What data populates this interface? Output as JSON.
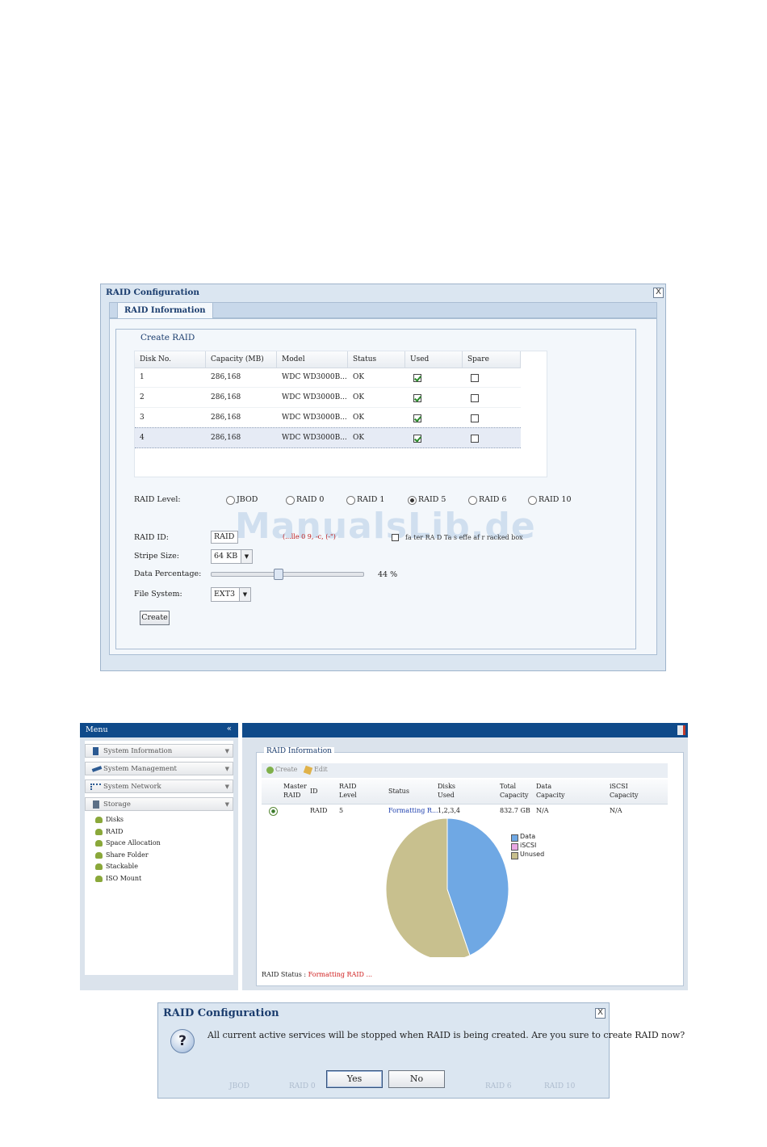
{
  "raid_config": {
    "title": "RAID Configuration",
    "close_label": "X",
    "tab": "RAID Information",
    "section": "Create RAID",
    "columns": [
      "Disk No.",
      "Capacity (MB)",
      "Model",
      "Status",
      "Used",
      "Spare"
    ],
    "disks": [
      {
        "no": "1",
        "capacity": "286,168",
        "model": "WDC WD3000B...",
        "status": "OK",
        "used": true,
        "spare": false
      },
      {
        "no": "2",
        "capacity": "286,168",
        "model": "WDC WD3000B...",
        "status": "OK",
        "used": true,
        "spare": false
      },
      {
        "no": "3",
        "capacity": "286,168",
        "model": "WDC WD3000B...",
        "status": "OK",
        "used": true,
        "spare": false
      },
      {
        "no": "4",
        "capacity": "286,168",
        "model": "WDC WD3000B...",
        "status": "OK",
        "used": true,
        "spare": false
      }
    ],
    "raid_level_label": "RAID Level:",
    "raid_levels": [
      "JBOD",
      "RAID 0",
      "RAID 1",
      "RAID 5",
      "RAID 6",
      "RAID 10"
    ],
    "raid_level_selected": "RAID 5",
    "raid_id_label": "RAID ID:",
    "raid_id_value": "RAID",
    "raid_id_hint": "(...lle 0 9, -c, (-\")",
    "master_hint": "fa ter RA D  Ta s effe  af  r  racked box",
    "stripe_label": "Stripe Size:",
    "stripe_value": "64 KB",
    "data_pct_label": "Data Percentage:",
    "data_pct_value": "44 %",
    "data_pct": 44,
    "fs_label": "File System:",
    "fs_value": "EXT3",
    "create_button": "Create",
    "watermark": "ManualsLib.de"
  },
  "nas": {
    "menu_title": "Menu",
    "menu_collapse": "«",
    "menu_items": [
      {
        "label": "System Information",
        "icon": "info-icon"
      },
      {
        "label": "System Management",
        "icon": "wrench-icon"
      },
      {
        "label": "System Network",
        "icon": "network-icon"
      },
      {
        "label": "Storage",
        "icon": "storage-icon"
      }
    ],
    "storage_sub": [
      "Disks",
      "RAID",
      "Space Allocation",
      "Share Folder",
      "Stackable",
      "ISO Mount"
    ],
    "section": "RAID Information",
    "toolbar": {
      "create": "Create",
      "edit": "Edit"
    },
    "columns": [
      "Master RAID",
      "ID",
      "RAID Level",
      "Status",
      "Disks Used",
      "Total Capacity",
      "Data Capacity",
      "iSCSI Capacity"
    ],
    "row": {
      "master": "●",
      "id": "RAID",
      "level": "5",
      "status": "Formatting R...",
      "disks": "1,2,3,4",
      "total": "832.7 GB",
      "data": "N/A",
      "iscsi": "N/A"
    },
    "legend": [
      {
        "label": "Data",
        "color": "#6fa8e4"
      },
      {
        "label": "iSCSI",
        "color": "#e9a7e4"
      },
      {
        "label": "Unused",
        "color": "#c8c08e"
      }
    ],
    "raid_status_label": "RAID Status :",
    "raid_status_value": "Formatting RAID ..."
  },
  "chart_data": {
    "type": "pie",
    "labels": [
      "Data",
      "iSCSI",
      "Unused"
    ],
    "values": [
      44,
      0,
      56
    ],
    "colors": [
      "#6fa8e4",
      "#e9a7e4",
      "#c8c08e"
    ],
    "legend": "top-right"
  },
  "confirm": {
    "title": "RAID Configuration",
    "close_label": "X",
    "message": "All current active services will be stopped when RAID is being created. Are you sure to create RAID now?",
    "yes": "Yes",
    "no": "No"
  },
  "ghost_text": [
    "JBOD",
    "RAID 0",
    "RAID 6",
    "RAID 10"
  ]
}
